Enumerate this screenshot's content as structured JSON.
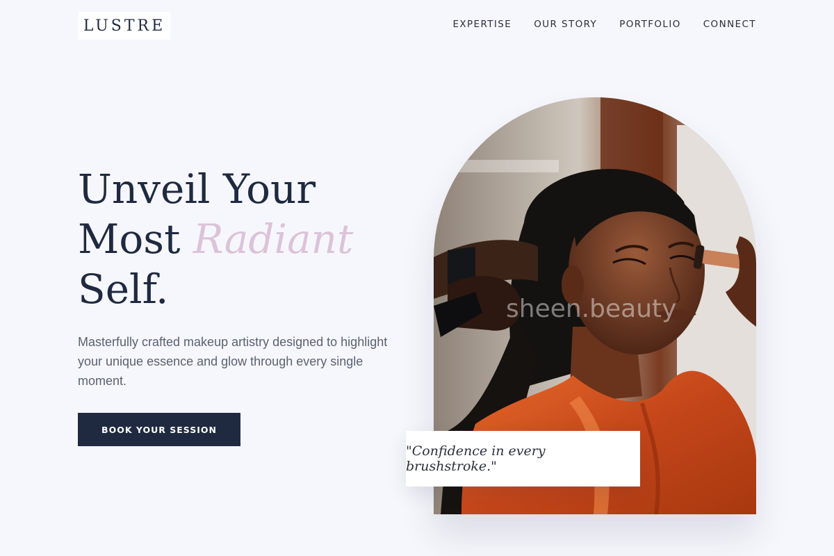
{
  "header": {
    "logo": "LUSTRE",
    "nav": [
      "EXPERTISE",
      "OUR STORY",
      "PORTFOLIO",
      "CONNECT"
    ]
  },
  "hero": {
    "headline_line1": "Unveil Your",
    "headline_line2_word": "Most",
    "headline_accent": "Radiant",
    "headline_line3": "Self.",
    "subtext": "Masterfully crafted makeup artistry designed to highlight your unique essence and glow through every single moment.",
    "cta_label": "BOOK YOUR SESSION",
    "watermark": "sheen.beauty",
    "quote": "\"Confidence in every brushstroke.\""
  },
  "colors": {
    "background": "#f6f7fc",
    "primary": "#1f2a40",
    "accent": "#dcc3d9",
    "muted_text": "#5a6170",
    "dress": "#d9581f"
  }
}
